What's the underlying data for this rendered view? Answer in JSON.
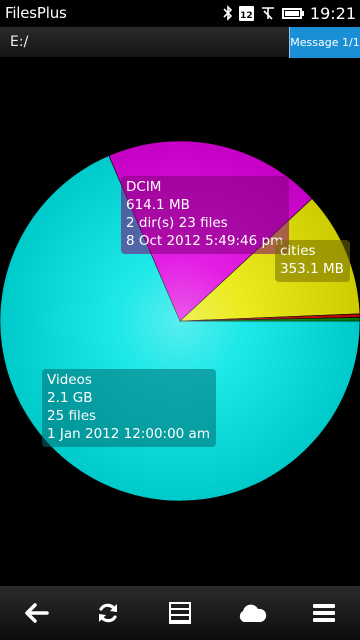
{
  "status_bar": {
    "app_title": "FilesPlus",
    "calendar_day": "12",
    "time": "19:21",
    "icons": [
      "bluetooth-icon",
      "calendar-icon",
      "no-signal-icon",
      "battery-icon"
    ]
  },
  "path_bar": {
    "path": "E:/"
  },
  "message_badge": {
    "label": "Message 1/1",
    "color": "#1a8fd6"
  },
  "chart_data": {
    "type": "pie",
    "title": "",
    "slices": [
      {
        "name": "Videos",
        "value": 2150.4,
        "color": "#00e5e5",
        "label_lines": [
          "Videos",
          "2.1 GB",
          "25 files",
          "1 Jan 2012 12:00:00 am"
        ]
      },
      {
        "name": "DCIM",
        "value": 614.1,
        "color": "#e000e0",
        "label_lines": [
          "DCIM",
          "614.1 MB",
          "2 dir(s) 23 files",
          "8 Oct 2012 5:49:46 pm"
        ]
      },
      {
        "name": "cities",
        "value": 353.1,
        "color": "#e8e800",
        "label_lines": [
          "cities",
          "353.1 MB"
        ]
      },
      {
        "name": "",
        "value": 10,
        "color": "#cc0000",
        "label_lines": []
      },
      {
        "name": "",
        "value": 10,
        "color": "#008800",
        "label_lines": []
      }
    ],
    "start_angle_deg": 0
  },
  "toolbar": {
    "buttons": [
      {
        "name": "back",
        "icon": "back-arrow-icon"
      },
      {
        "name": "refresh",
        "icon": "refresh-icon"
      },
      {
        "name": "list",
        "icon": "list-icon"
      },
      {
        "name": "cloud",
        "icon": "cloud-icon"
      },
      {
        "name": "menu",
        "icon": "menu-icon"
      }
    ]
  }
}
